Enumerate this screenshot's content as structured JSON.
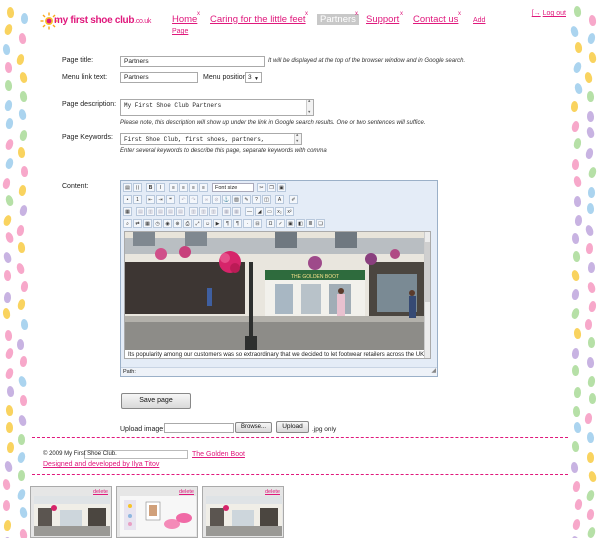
{
  "logo": {
    "text": "my first shoe club",
    "domain": ".co.uk"
  },
  "nav": {
    "items": [
      {
        "label": "Home",
        "active": false
      },
      {
        "label": "Caring for the little feet",
        "active": false
      },
      {
        "label": "Partners",
        "active": true
      },
      {
        "label": "Support",
        "active": false
      },
      {
        "label": "Contact us",
        "active": false
      }
    ],
    "close_glyph": "x",
    "add_page_line1": "Add",
    "add_page_line2": "Page"
  },
  "logout": "Log out",
  "form": {
    "page_title_label": "Page title:",
    "page_title_value": "Partners",
    "page_title_hint": "It will be displayed at the top of the browser window and in Google search.",
    "menu_link_label": "Menu link text:",
    "menu_link_value": "Partners",
    "menu_position_label": "Menu position:",
    "menu_position_value": "3",
    "description_label": "Page description:",
    "description_value": "My First Shoe Club Partners",
    "description_hint": "Please note, this description will show up under the link in Google search results. One or two sentences will suffice.",
    "keywords_label": "Page Keywords:",
    "keywords_value": "First Shoe Club, first shoes, partners,",
    "keywords_hint": "Enter several keywords to describe this page, separate keywords with comma",
    "content_label": "Content:"
  },
  "editor": {
    "font_select": "Font size",
    "store_sign": "THE GOLDEN BOOT",
    "caption": "Its popularity among our customers was so extraordinary that we decided to let footwear retailers across the UK",
    "path_label": "Path:"
  },
  "save_button": "Save page",
  "upload": {
    "label": "Upload image:",
    "browse": "Browse...",
    "upload_button": "Upload",
    "note": ".jpg only"
  },
  "footer": {
    "copyright": "© 2009 My First Shoe Club.",
    "golden_boot": "The Golden Boot",
    "designed_by": "Designed and developed by Ilya Titov"
  },
  "thumbnails": [
    {
      "delete": "delete"
    },
    {
      "delete": "delete"
    },
    {
      "delete": "delete"
    }
  ],
  "colors": {
    "accent": "#e0187c",
    "editor_bg": "#e4ecf7"
  }
}
